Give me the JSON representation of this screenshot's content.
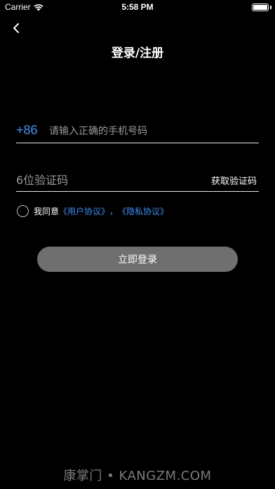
{
  "status_bar": {
    "carrier": "Carrier",
    "time": "5:58 PM",
    "icons": [
      "wifi-icon",
      "battery-icon"
    ]
  },
  "nav": {
    "back_icon": "chevron-left-icon",
    "title": "登录/注册"
  },
  "phone": {
    "country_code": "+86",
    "placeholder": "请输入正确的手机号码",
    "value": ""
  },
  "code": {
    "placeholder": "6位验证码",
    "value": "",
    "get_code_label": "获取验证码"
  },
  "agreement": {
    "checked": false,
    "prefix": "我同意",
    "user_agreement": "《用户协议》",
    "separator": "，",
    "privacy_agreement": "《隐私协议》"
  },
  "login_button": {
    "label": "立即登录"
  },
  "watermark": "康掌门 • KANGZM.COM",
  "colors": {
    "background": "#000000",
    "accent": "#3f8cf5",
    "button": "#6f6f6f",
    "placeholder": "#9a9a9a"
  }
}
